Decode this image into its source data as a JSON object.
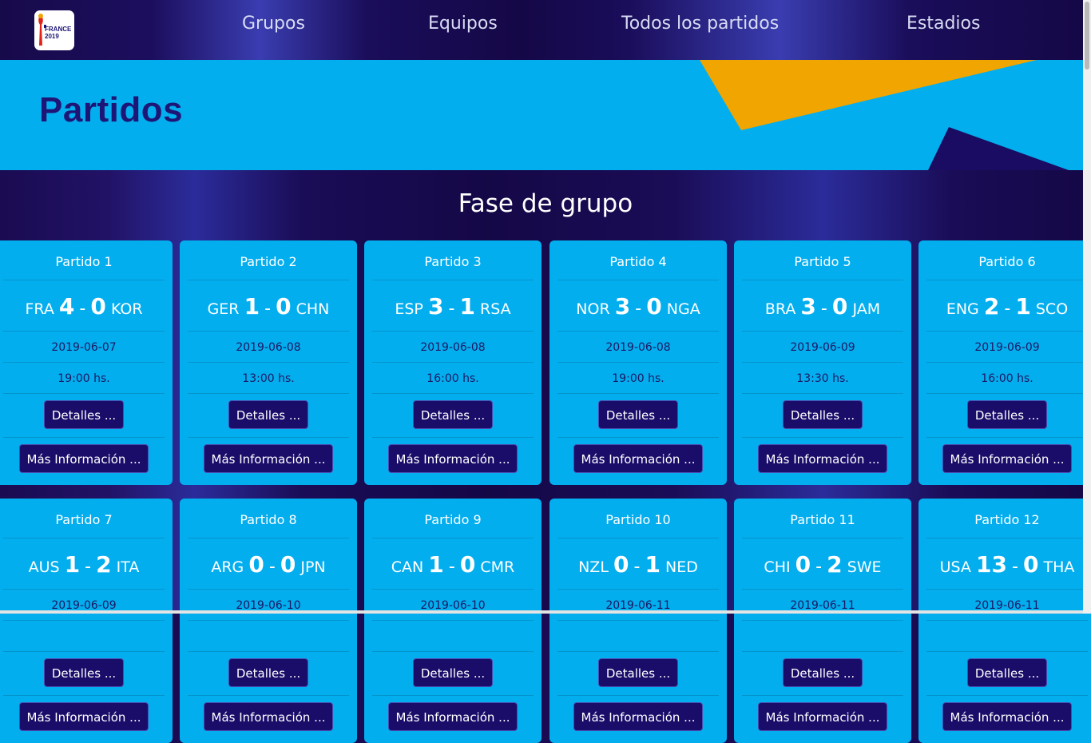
{
  "nav": {
    "logo_text": "FRANCE 2019",
    "links": [
      "Grupos",
      "Equipos",
      "Todos los partidos",
      "Estadios"
    ]
  },
  "hero": {
    "title": "Partidos"
  },
  "section": {
    "title": "Fase de grupo"
  },
  "button_labels": {
    "details": "Detalles ...",
    "more": "Más Información ..."
  },
  "matches": [
    {
      "title": "Partido 1",
      "home": "FRA",
      "home_goals": "4",
      "away_goals": "0",
      "away": "KOR",
      "date": "2019-06-07",
      "time": "19:00 hs."
    },
    {
      "title": "Partido 2",
      "home": "GER",
      "home_goals": "1",
      "away_goals": "0",
      "away": "CHN",
      "date": "2019-06-08",
      "time": "13:00 hs."
    },
    {
      "title": "Partido 3",
      "home": "ESP",
      "home_goals": "3",
      "away_goals": "1",
      "away": "RSA",
      "date": "2019-06-08",
      "time": "16:00 hs."
    },
    {
      "title": "Partido 4",
      "home": "NOR",
      "home_goals": "3",
      "away_goals": "0",
      "away": "NGA",
      "date": "2019-06-08",
      "time": "19:00 hs."
    },
    {
      "title": "Partido 5",
      "home": "BRA",
      "home_goals": "3",
      "away_goals": "0",
      "away": "JAM",
      "date": "2019-06-09",
      "time": "13:30 hs."
    },
    {
      "title": "Partido 6",
      "home": "ENG",
      "home_goals": "2",
      "away_goals": "1",
      "away": "SCO",
      "date": "2019-06-09",
      "time": "16:00 hs."
    },
    {
      "title": "Partido 7",
      "home": "AUS",
      "home_goals": "1",
      "away_goals": "2",
      "away": "ITA",
      "date": "2019-06-09",
      "time": ""
    },
    {
      "title": "Partido 8",
      "home": "ARG",
      "home_goals": "0",
      "away_goals": "0",
      "away": "JPN",
      "date": "2019-06-10",
      "time": ""
    },
    {
      "title": "Partido 9",
      "home": "CAN",
      "home_goals": "1",
      "away_goals": "0",
      "away": "CMR",
      "date": "2019-06-10",
      "time": ""
    },
    {
      "title": "Partido 10",
      "home": "NZL",
      "home_goals": "0",
      "away_goals": "1",
      "away": "NED",
      "date": "2019-06-11",
      "time": ""
    },
    {
      "title": "Partido 11",
      "home": "CHI",
      "home_goals": "0",
      "away_goals": "2",
      "away": "SWE",
      "date": "2019-06-11",
      "time": ""
    },
    {
      "title": "Partido 12",
      "home": "USA",
      "home_goals": "13",
      "away_goals": "0",
      "away": "THA",
      "date": "2019-06-11",
      "time": ""
    }
  ],
  "colors": {
    "navy": "#1a0b52",
    "cyan": "#03aeef",
    "orange": "#f1a500",
    "button": "#1a0d6a",
    "title_text": "#1e1676"
  }
}
